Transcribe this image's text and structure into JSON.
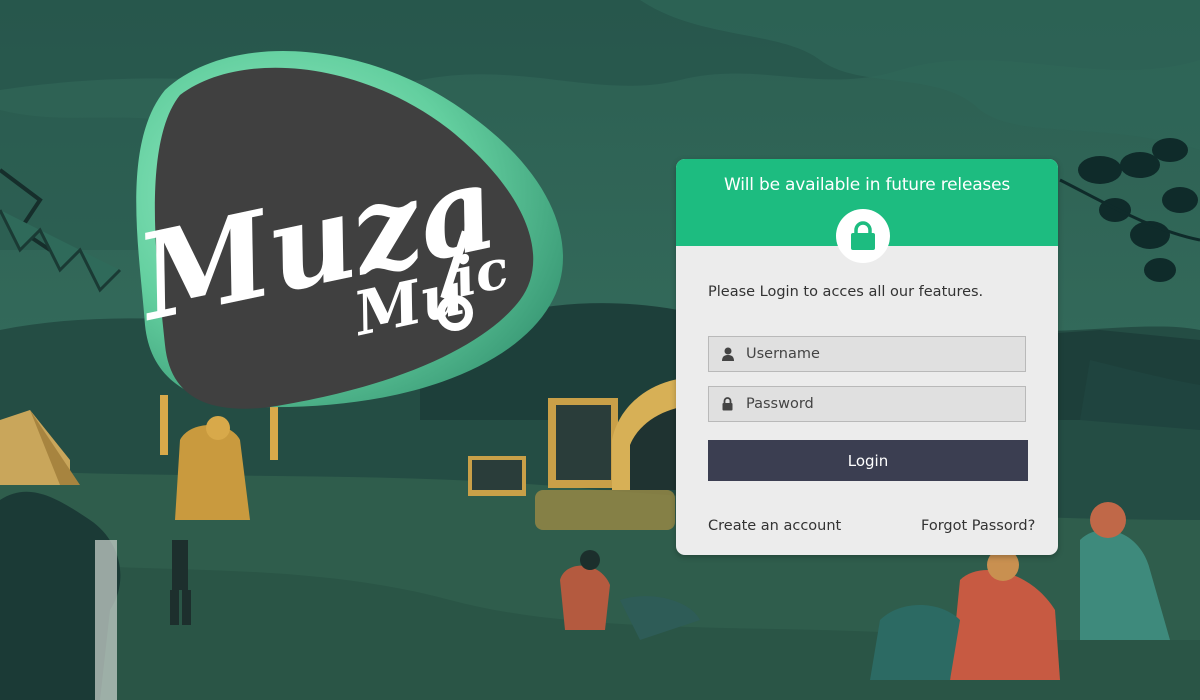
{
  "brand": {
    "logo_alt": "Muza Music",
    "logo_text_line1": "Muza",
    "logo_text_line2": "Music"
  },
  "login_card": {
    "header_title": "Will be available in future releases",
    "lock_icon": "lock-icon",
    "intro_text": "Please Login to acces all our features.",
    "username_placeholder": "Username",
    "password_placeholder": "Password",
    "username_icon": "user-icon",
    "password_icon": "lock-icon",
    "login_label": "Login",
    "create_account_label": "Create an account",
    "forgot_password_label": "Forgot Passord?"
  },
  "colors": {
    "accent_green": "#1dbc80",
    "button_dark": "#3b3e51",
    "card_bg": "#ececec",
    "scene_green": "#2b5a4e",
    "logo_pick": "#404040"
  }
}
